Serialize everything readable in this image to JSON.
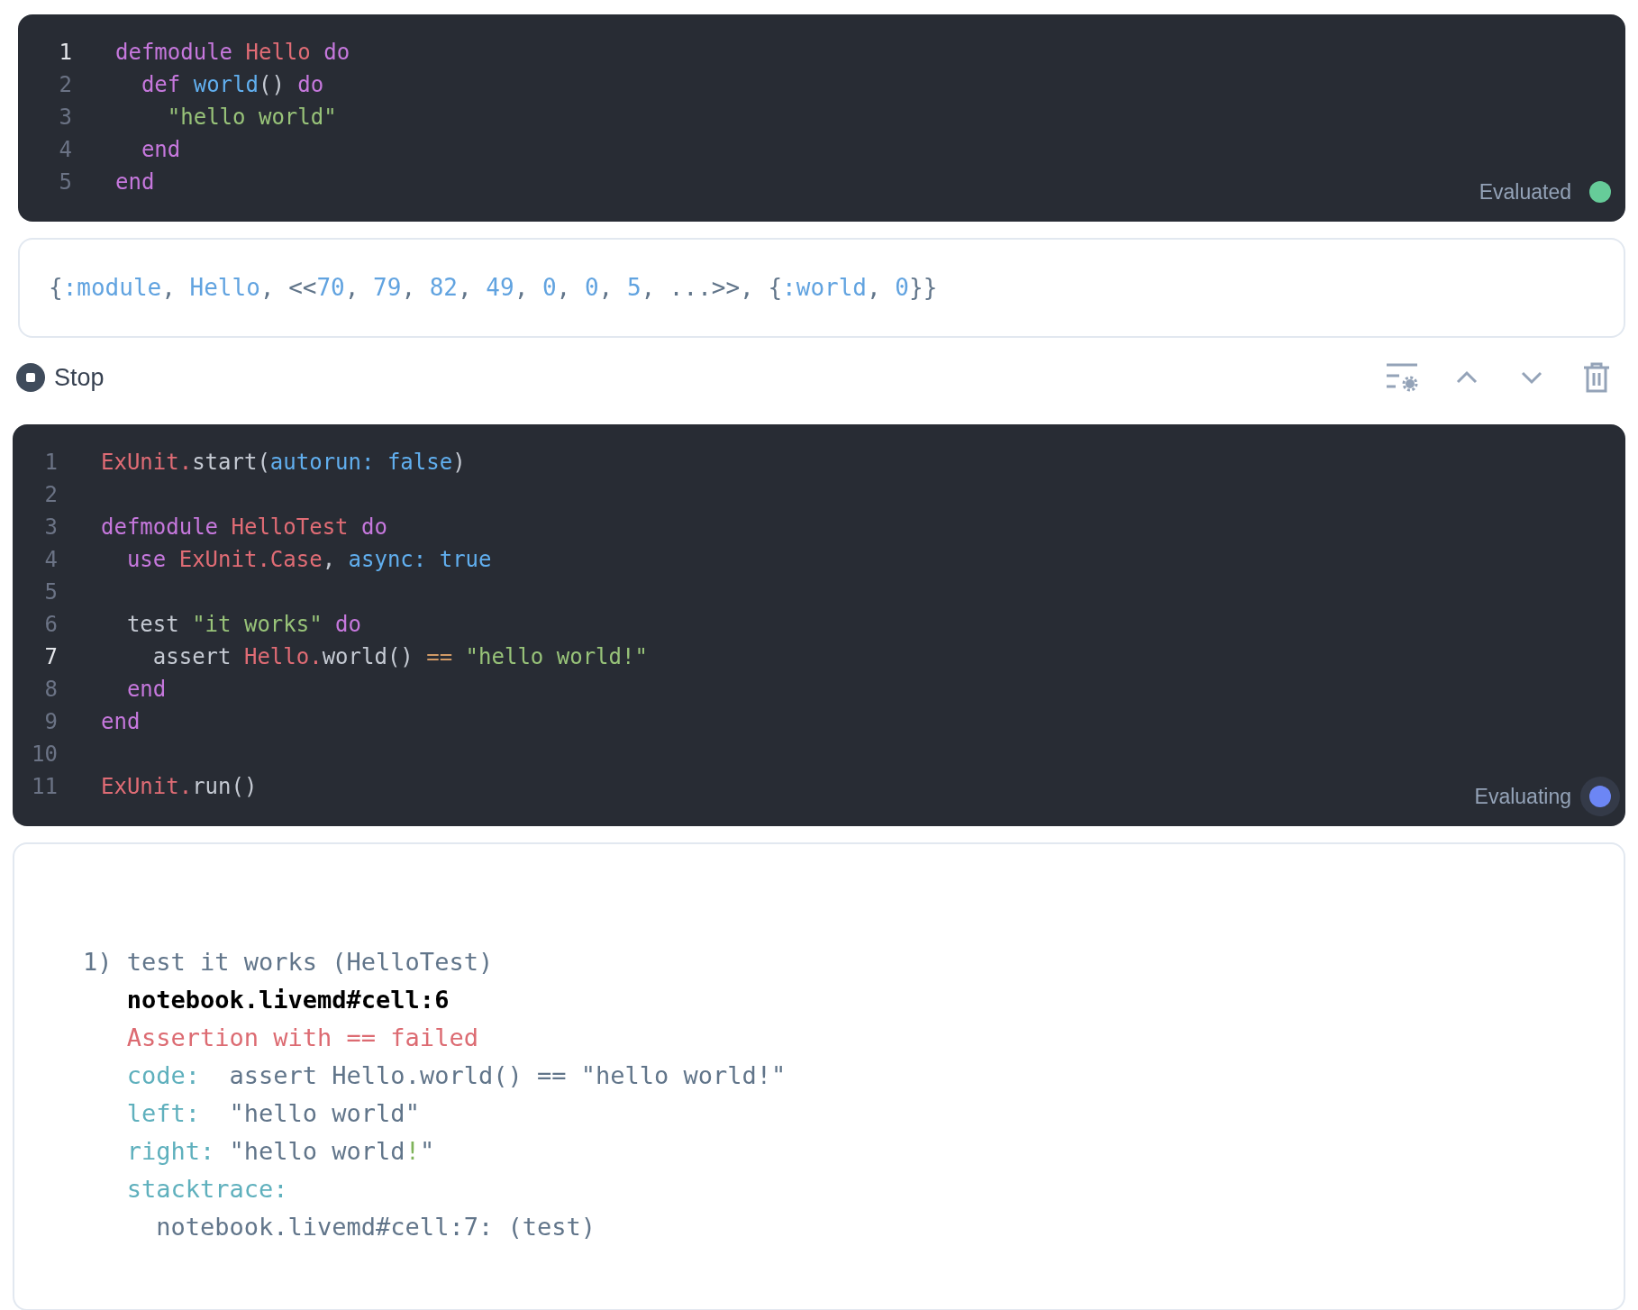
{
  "cells": [
    {
      "status": {
        "label": "Evaluated",
        "running": false
      },
      "lines": [
        {
          "number": "1",
          "active": true,
          "tokens": [
            {
              "kind": "keyword",
              "text": "defmodule "
            },
            {
              "kind": "module",
              "text": "Hello "
            },
            {
              "kind": "keyword",
              "text": "do"
            }
          ]
        },
        {
          "number": "2",
          "active": false,
          "tokens": [
            {
              "kind": "keyword",
              "text": "  def "
            },
            {
              "kind": "function",
              "text": "world"
            },
            {
              "kind": "plain",
              "text": "() "
            },
            {
              "kind": "keyword",
              "text": "do"
            }
          ]
        },
        {
          "number": "3",
          "active": false,
          "tokens": [
            {
              "kind": "string",
              "text": "    \"hello world\""
            }
          ]
        },
        {
          "number": "4",
          "active": false,
          "tokens": [
            {
              "kind": "keyword",
              "text": "  end"
            }
          ]
        },
        {
          "number": "5",
          "active": false,
          "tokens": [
            {
              "kind": "keyword",
              "text": "end"
            }
          ]
        }
      ],
      "output": {
        "kind": "value",
        "lines": [
          [
            {
              "kind": "punct",
              "text": "{"
            },
            {
              "kind": "atom",
              "text": ":module"
            },
            {
              "kind": "punct",
              "text": ", "
            },
            {
              "kind": "atom",
              "text": "Hello"
            },
            {
              "kind": "punct",
              "text": ", <<"
            },
            {
              "kind": "atom",
              "text": "70"
            },
            {
              "kind": "punct",
              "text": ", "
            },
            {
              "kind": "atom",
              "text": "79"
            },
            {
              "kind": "punct",
              "text": ", "
            },
            {
              "kind": "atom",
              "text": "82"
            },
            {
              "kind": "punct",
              "text": ", "
            },
            {
              "kind": "atom",
              "text": "49"
            },
            {
              "kind": "punct",
              "text": ", "
            },
            {
              "kind": "atom",
              "text": "0"
            },
            {
              "kind": "punct",
              "text": ", "
            },
            {
              "kind": "atom",
              "text": "0"
            },
            {
              "kind": "punct",
              "text": ", "
            },
            {
              "kind": "atom",
              "text": "5"
            },
            {
              "kind": "punct",
              "text": ", ...>>, {"
            },
            {
              "kind": "atom",
              "text": ":world"
            },
            {
              "kind": "punct",
              "text": ", "
            },
            {
              "kind": "atom",
              "text": "0"
            },
            {
              "kind": "punct",
              "text": "}}"
            }
          ]
        ]
      }
    },
    {
      "toolbar": {
        "stop_label": "Stop"
      },
      "status": {
        "label": "Evaluating",
        "running": true
      },
      "lines": [
        {
          "number": "1",
          "active": false,
          "tokens": [
            {
              "kind": "module",
              "text": "ExUnit."
            },
            {
              "kind": "plain",
              "text": "start("
            },
            {
              "kind": "function",
              "text": "autorun: false"
            },
            {
              "kind": "plain",
              "text": ")"
            }
          ]
        },
        {
          "number": "2",
          "active": false
        },
        {
          "number": "3",
          "active": false,
          "tokens": [
            {
              "kind": "keyword",
              "text": "defmodule "
            },
            {
              "kind": "module",
              "text": "HelloTest "
            },
            {
              "kind": "keyword",
              "text": "do"
            }
          ]
        },
        {
          "number": "4",
          "active": false,
          "tokens": [
            {
              "kind": "keyword",
              "text": "  use "
            },
            {
              "kind": "module",
              "text": "ExUnit.Case"
            },
            {
              "kind": "plain",
              "text": ", "
            },
            {
              "kind": "function",
              "text": "async: true"
            }
          ]
        },
        {
          "number": "5",
          "active": false
        },
        {
          "number": "6",
          "active": false,
          "tokens": [
            {
              "kind": "plain",
              "text": "  test "
            },
            {
              "kind": "string",
              "text": "\"it works\" "
            },
            {
              "kind": "keyword",
              "text": "do"
            }
          ]
        },
        {
          "number": "7",
          "active": true,
          "tokens": [
            {
              "kind": "plain",
              "text": "    assert "
            },
            {
              "kind": "module",
              "text": "Hello."
            },
            {
              "kind": "plain",
              "text": "world() "
            },
            {
              "kind": "operator",
              "text": "== "
            },
            {
              "kind": "string",
              "text": "\"hello world!\""
            }
          ]
        },
        {
          "number": "8",
          "active": false,
          "tokens": [
            {
              "kind": "keyword",
              "text": "  end"
            }
          ]
        },
        {
          "number": "9",
          "active": false,
          "tokens": [
            {
              "kind": "keyword",
              "text": "end"
            }
          ]
        },
        {
          "number": "10",
          "active": false
        },
        {
          "number": "11",
          "active": false,
          "tokens": [
            {
              "kind": "module",
              "text": "ExUnit."
            },
            {
              "kind": "plain",
              "text": "run()"
            }
          ]
        }
      ],
      "output": {
        "kind": "log",
        "lines": [
          [
            {
              "kind": "punct",
              "text": "1) test it works (HelloTest)"
            }
          ],
          [
            {
              "kind": "bold",
              "text": "   notebook.livemd#cell:6"
            }
          ],
          [
            {
              "kind": "error",
              "text": "   Assertion with == failed"
            }
          ],
          [
            {
              "kind": "label",
              "text": "   code:  "
            },
            {
              "kind": "punct",
              "text": "assert Hello.world() == \"hello world!\""
            }
          ],
          [
            {
              "kind": "label",
              "text": "   left:  "
            },
            {
              "kind": "punct",
              "text": "\"hello world\""
            }
          ],
          [
            {
              "kind": "label",
              "text": "   right: "
            },
            {
              "kind": "punct",
              "text": "\"hello world"
            },
            {
              "kind": "diff",
              "text": "!"
            },
            {
              "kind": "punct",
              "text": "\""
            }
          ],
          [
            {
              "kind": "label",
              "text": "   stacktrace:"
            }
          ],
          [
            {
              "kind": "punct",
              "text": "     notebook.livemd#cell:7: (test)"
            }
          ]
        ]
      }
    }
  ]
}
